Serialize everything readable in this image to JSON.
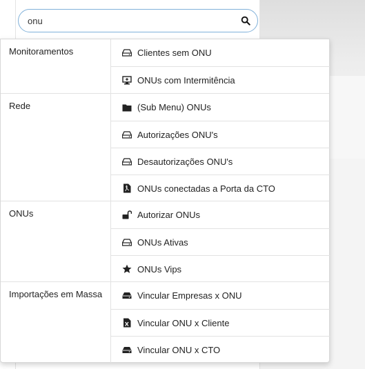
{
  "search": {
    "value": "onu"
  },
  "groups": [
    {
      "label": "Monitoramentos",
      "items": [
        {
          "label": "Clientes sem ONU",
          "icon": "hdd-icon"
        },
        {
          "label": "ONUs com Intermitência",
          "icon": "monitor-icon"
        }
      ]
    },
    {
      "label": "Rede",
      "items": [
        {
          "label": "(Sub Menu) ONUs",
          "icon": "folder-icon"
        },
        {
          "label": "Autorizações ONU's",
          "icon": "hdd-icon"
        },
        {
          "label": "Desautorizações ONU's",
          "icon": "hdd-icon"
        },
        {
          "label": "ONUs conectadas a Porta da CTO",
          "icon": "pdf-file-icon"
        }
      ]
    },
    {
      "label": "ONUs",
      "items": [
        {
          "label": "Autorizar ONUs",
          "icon": "unlock-icon"
        },
        {
          "label": "ONUs Ativas",
          "icon": "hdd-icon"
        },
        {
          "label": "ONUs Vips",
          "icon": "star-icon"
        }
      ]
    },
    {
      "label": "Importações em Massa",
      "items": [
        {
          "label": "Vincular Empresas x ONU",
          "icon": "hdd-solid-icon"
        },
        {
          "label": "Vincular ONU x Cliente",
          "icon": "excel-file-icon"
        },
        {
          "label": "Vincular ONU x CTO",
          "icon": "hdd-solid-icon"
        }
      ]
    }
  ]
}
